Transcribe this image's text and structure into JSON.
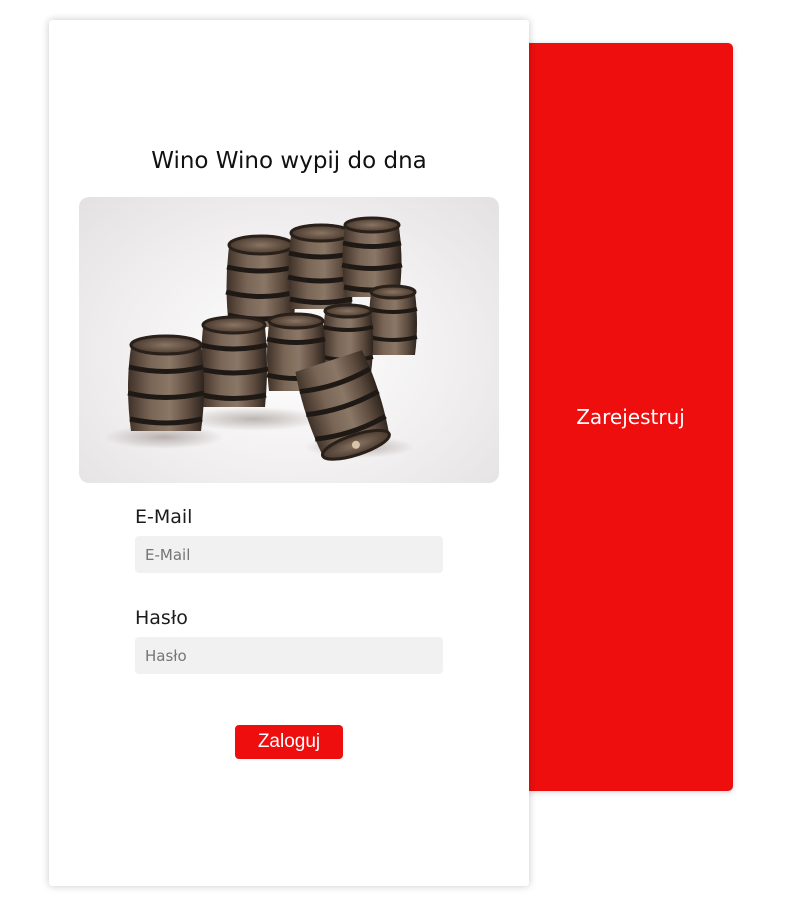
{
  "register": {
    "label": "Zarejestruj",
    "color": "#ee0e0e"
  },
  "login": {
    "title": "Wino Wino wypij do dna",
    "hero_image": "wine-barrels-image",
    "email": {
      "label": "E-Mail",
      "placeholder": "E-Mail",
      "value": ""
    },
    "password": {
      "label": "Hasło",
      "placeholder": "Hasło",
      "value": ""
    },
    "submit_label": "Zaloguj",
    "accent_color": "#ee0e0e"
  }
}
